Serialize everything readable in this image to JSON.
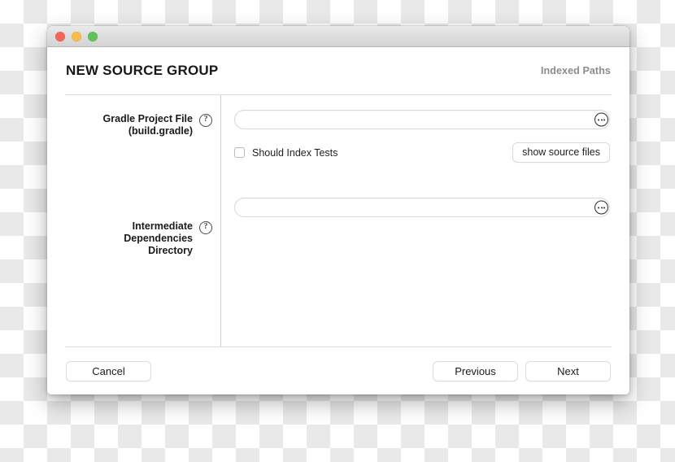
{
  "window": {
    "traffic_lights": [
      {
        "name": "close",
        "color": "#f6655b"
      },
      {
        "name": "minimize",
        "color": "#f9bd4e"
      },
      {
        "name": "maximize",
        "color": "#5ec45a"
      }
    ]
  },
  "header": {
    "title": "NEW SOURCE GROUP",
    "right_label": "Indexed Paths"
  },
  "fields": [
    {
      "label_line1": "Gradle Project File",
      "label_line2": "(build.gradle)",
      "help": "?",
      "value": "",
      "placeholder": "",
      "browse_icon": "ellipsis-icon"
    },
    {
      "label_line1": "Intermediate",
      "label_line2": "Dependencies Directory",
      "help": "?",
      "value": "",
      "placeholder": "",
      "browse_icon": "ellipsis-icon"
    }
  ],
  "options": {
    "index_tests_label": "Should Index Tests",
    "index_tests_checked": false,
    "show_source_files_label": "show source files"
  },
  "footer": {
    "cancel_label": "Cancel",
    "previous_label": "Previous",
    "next_label": "Next"
  }
}
